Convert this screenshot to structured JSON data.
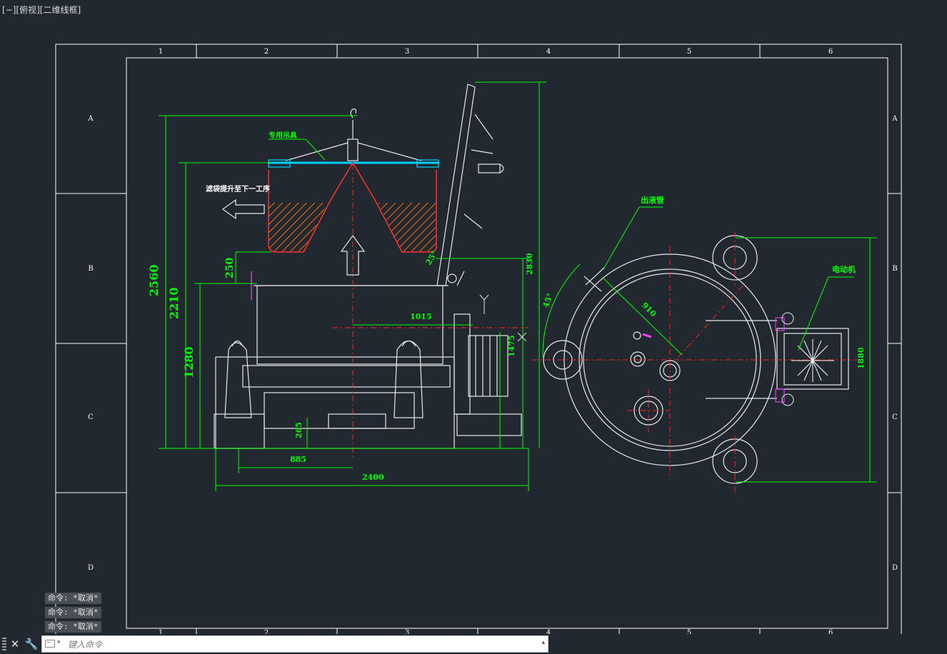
{
  "viewport": {
    "label": "[−][俯视][二维线框]"
  },
  "frame": {
    "columns": [
      "1",
      "2",
      "3",
      "4",
      "5",
      "6"
    ],
    "rows": [
      "A",
      "B",
      "C",
      "D"
    ]
  },
  "annotations": {
    "hoist": "专用吊具",
    "lift_note": "滤袋提升至下一工序",
    "outlet_pipe": "出液管",
    "motor": "电动机"
  },
  "dimensions": {
    "d2560": "2560",
    "d2210": "2210",
    "d1280": "1280",
    "d250": "250",
    "d2830": "2830",
    "d1015": "1015",
    "d1475": "1475",
    "d265": "265",
    "d885": "885",
    "d2400": "2400",
    "d1880": "1880",
    "d910": "910",
    "a45": "45°",
    "a25": "25°"
  },
  "command_history": [
    "命令: *取消*",
    "命令: *取消*",
    "命令: *取消*"
  ],
  "command_input": {
    "placeholder": "键入命令"
  },
  "colors": {
    "background": "#212830",
    "lines": "#e8e8e8",
    "dimension": "#00ff00",
    "center": "#ff2020",
    "accent": "#00d0ff"
  }
}
